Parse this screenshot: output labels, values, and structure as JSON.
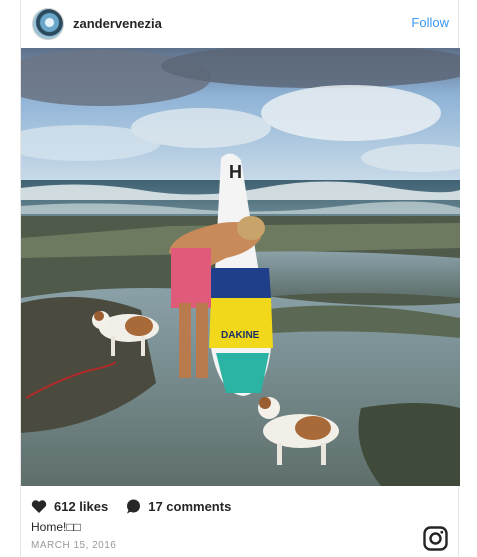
{
  "post": {
    "username": "zandervenezia",
    "follow_label": "Follow",
    "likes": "612 likes",
    "comments": "17 comments",
    "caption": "Home!□□",
    "date": "MARCH 15, 2016"
  },
  "photo": {
    "description_icon": "photo",
    "board_text": "DAKINE"
  },
  "icons": {
    "avatar": "avatar",
    "like": "heart-icon",
    "comment": "comment-icon",
    "brand": "instagram-icon"
  },
  "colors": {
    "follow": "#3897f0",
    "date": "#999999",
    "text": "#262626"
  }
}
